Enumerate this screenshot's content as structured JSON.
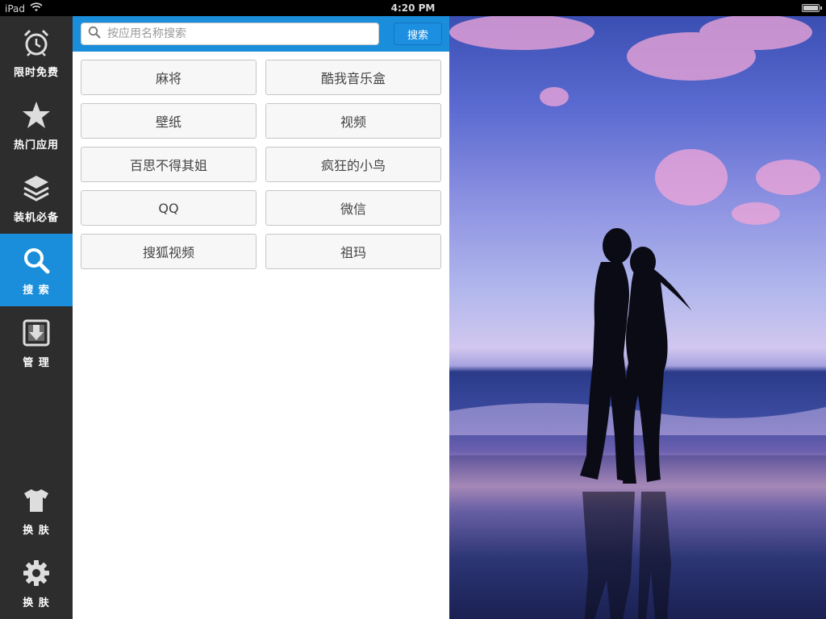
{
  "status_bar": {
    "device": "iPad",
    "time": "4:20 PM"
  },
  "sidebar": {
    "items": [
      {
        "label": "限时免费",
        "icon": "alarm-clock-icon"
      },
      {
        "label": "热门应用",
        "icon": "star-icon"
      },
      {
        "label": "装机必备",
        "icon": "layers-icon"
      },
      {
        "label": "搜 索",
        "icon": "search-icon",
        "active": true
      },
      {
        "label": "管 理",
        "icon": "download-box-icon"
      },
      {
        "label": "换 肤",
        "icon": "tshirt-icon"
      },
      {
        "label": "换 肤",
        "icon": "gear-icon"
      }
    ]
  },
  "search": {
    "placeholder": "按应用名称搜索",
    "value": "",
    "button_label": "搜索"
  },
  "hot_keywords": [
    "麻将",
    "酷我音乐盒",
    "壁纸",
    "视频",
    "百思不得其姐",
    "疯狂的小鸟",
    "QQ",
    "微信",
    "搜狐视频",
    "祖玛"
  ],
  "colors": {
    "accent": "#1a8edb",
    "sidebar_bg": "#2d2d2d"
  }
}
